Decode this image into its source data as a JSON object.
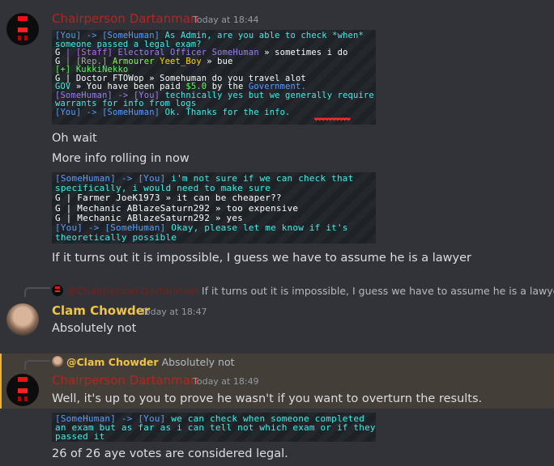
{
  "messages": {
    "m1": {
      "author": "Chairperson Dartanman",
      "timestamp": "Today at 18:44",
      "screenshot_lines": [
        [
          [
            "[You] -> [SomeHuman] ",
            "c-lblue"
          ],
          [
            "As Admin, are you able to check *when*",
            "c-cyan"
          ]
        ],
        [
          [
            "someone passed a legal exam?",
            "c-cyan"
          ]
        ],
        [
          [
            "G ",
            "c-white"
          ],
          [
            "| [Staff] ",
            "c-purple"
          ],
          [
            "Electoral Officer SomeHuman",
            "c-pink"
          ],
          [
            " » sometimes i do",
            "c-white"
          ]
        ],
        [
          [
            "G ",
            "c-white"
          ],
          [
            "| [Rep.] ",
            "c-grey"
          ],
          [
            "Armourer ",
            "c-lime"
          ],
          [
            "Yeet_Boy",
            "c-gold"
          ],
          [
            " » bue",
            "c-white"
          ]
        ],
        [
          [
            "[+] ",
            "c-green"
          ],
          [
            "KukkiNekko",
            "c-green"
          ]
        ],
        [
          [
            "G ",
            "c-white"
          ],
          [
            "| Doctor FTOWop » Somehuman do you travel alot",
            "c-white"
          ]
        ],
        [
          [
            "GOV ",
            "c-cyan"
          ],
          [
            "» You have been paid ",
            "c-white"
          ],
          [
            "$5.0",
            "c-green"
          ],
          [
            " by the ",
            "c-white"
          ],
          [
            "Government.",
            "c-lblue"
          ]
        ],
        [
          [
            "[SomeHuman] -> [You] ",
            "c-pink"
          ],
          [
            "technically yes but we generally require",
            "c-cyan"
          ]
        ],
        [
          [
            "warrants for info from logs",
            "c-cyan"
          ]
        ],
        [
          [
            "[You] -> [SomeHuman] ",
            "c-lblue"
          ],
          [
            "Ok. Thanks for the info.",
            "c-cyan"
          ]
        ]
      ],
      "hearts": "❤❤❤❤❤❤❤❤❤❤",
      "lines": [
        "Oh wait",
        "More info rolling in now"
      ]
    },
    "m1b_lines": [
      [
        [
          "[SomeHuman] -> [You] ",
          "c-lblue"
        ],
        [
          "i'm not sure if we can check that",
          "c-cyan"
        ]
      ],
      [
        [
          "specifically, i would need to make sure",
          "c-cyan"
        ]
      ],
      [
        [
          "G ",
          "c-white"
        ],
        [
          "| Farmer JoeK1973 » it can be cheaper??",
          "c-white"
        ]
      ],
      [
        [
          "G ",
          "c-white"
        ],
        [
          "| Mechanic ABlazeSaturn292 » too expensive",
          "c-white"
        ]
      ],
      [
        [
          "G ",
          "c-white"
        ],
        [
          "| Mechanic ABlazeSaturn292 » yes",
          "c-white"
        ]
      ],
      [
        [
          "[You] -> [SomeHuman] ",
          "c-lblue"
        ],
        [
          "Okay, please let me know if it's",
          "c-cyan"
        ]
      ],
      [
        [
          "theoretically possible",
          "c-cyan"
        ]
      ]
    ],
    "m1c": "If it turns out it is impossible, I guess we have to assume he is a lawyer",
    "m2": {
      "reply_author": "@Chairperson Dartanman",
      "reply_text": "If it turns out it is impossible, I guess we have to assume he is a lawyer",
      "author": "Clam Chowder",
      "timestamp": "Today at 18:47",
      "text": "Absolutely not"
    },
    "m3": {
      "reply_author": "@Clam Chowder",
      "reply_text": "Absolutely not",
      "author": "Chairperson Dartanman",
      "timestamp": "Today at 18:49",
      "text": "Well, it's up to you to prove he wasn't if you want to overturn the results.",
      "screenshot_lines": [
        [
          [
            "[SomeHuman] -> [You] ",
            "c-lblue"
          ],
          [
            "we can check when someone completed",
            "c-cyan"
          ]
        ],
        [
          [
            "an exam but as far as i can tell not which exam or if they",
            "c-cyan"
          ]
        ],
        [
          [
            "passed it",
            "c-cyan"
          ]
        ]
      ],
      "text2": "26 of 26 aye votes are considered legal."
    }
  },
  "colors": {
    "background": "#313338",
    "dartanman": "#b3261e",
    "clam": "#f0c445",
    "highlight": "#443e38"
  }
}
